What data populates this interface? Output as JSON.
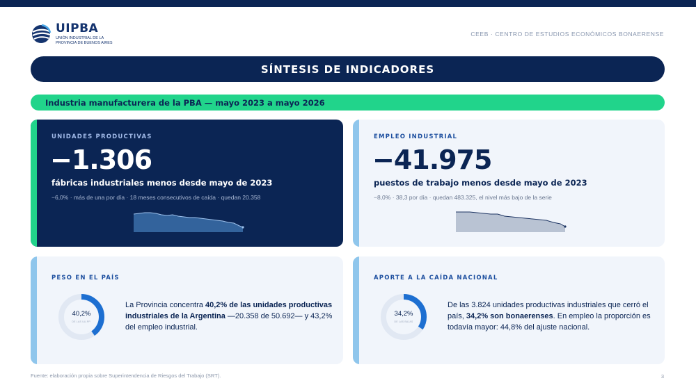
{
  "header": {
    "logo_name": "UIPBA",
    "logo_subtitle": "UNIÓN INDUSTRIAL DE LA PROVINCIA DE BUENOS AIRES",
    "right_text": "CEEB · CENTRO DE ESTUDIOS ECONÓMICOS BONAERENSE"
  },
  "title": "SÍNTESIS DE INDICADORES",
  "subtitle": "Industria manufacturera de la PBA — mayo 2023 a mayo 2026",
  "cards": {
    "unidades": {
      "label": "UNIDADES PRODUCTIVAS",
      "value": "−1.306",
      "desc": "fábricas industriales menos desde mayo de 2023",
      "note": "−6,0% · más de una por día · 18 meses consecutivos de caída · quedan 20.358"
    },
    "empleo": {
      "label": "EMPLEO INDUSTRIAL",
      "value": "−41.975",
      "desc": "puestos de trabajo menos desde mayo de 2023",
      "note": "−8,0% · 38,3 por día · quedan 483.325, el nivel más bajo de la serie"
    },
    "peso": {
      "label": "PESO EN EL PAÍS",
      "donut_value": "40,2%",
      "donut_fraction": 0.402,
      "donut_caption": "DE LAS UU.PP.",
      "text_pre": "La Provincia concentra ",
      "text_bold": "40,2% de las unidades productivas industriales de la Argentina",
      "text_post": " —20.358 de 50.692— y 43,2% del empleo industrial."
    },
    "aporte": {
      "label": "APORTE A LA CAÍDA NACIONAL",
      "donut_value": "34,2%",
      "donut_fraction": 0.342,
      "donut_caption": "DE LAS BAJAS",
      "text_pre": "De las 3.824 unidades productivas industriales que cerró el país, ",
      "text_bold": "34,2% son bonaerenses",
      "text_post": ". En empleo la proporción es todavía mayor: 44,8% del ajuste nacional."
    }
  },
  "colors": {
    "navy": "#0b2554",
    "green": "#21d48b",
    "light_blue": "#8fc6ec",
    "blue": "#1d6fd1"
  },
  "footer": {
    "source": "Fuente: elaboración propia sobre Superintendencia de Riesgos del Trabajo (SRT).",
    "page": "3"
  }
}
